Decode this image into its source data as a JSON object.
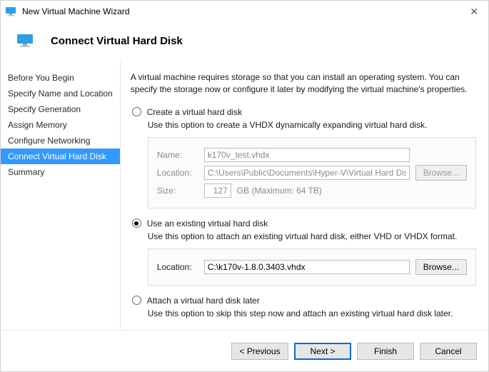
{
  "titlebar": {
    "text": "New Virtual Machine Wizard"
  },
  "header": {
    "title": "Connect Virtual Hard Disk"
  },
  "sidebar": {
    "items": [
      {
        "label": "Before You Begin"
      },
      {
        "label": "Specify Name and Location"
      },
      {
        "label": "Specify Generation"
      },
      {
        "label": "Assign Memory"
      },
      {
        "label": "Configure Networking"
      },
      {
        "label": "Connect Virtual Hard Disk"
      },
      {
        "label": "Summary"
      }
    ]
  },
  "content": {
    "intro": "A virtual machine requires storage so that you can install an operating system. You can specify the storage now or configure it later by modifying the virtual machine's properties.",
    "opt_create": {
      "label": "Create a virtual hard disk",
      "desc": "Use this option to create a VHDX dynamically expanding virtual hard disk.",
      "name_label": "Name:",
      "name_value": "k170v_test.vhdx",
      "location_label": "Location:",
      "location_value": "C:\\Users\\Public\\Documents\\Hyper-V\\Virtual Hard Disks\\",
      "browse_label": "Browse...",
      "size_label": "Size:",
      "size_value": "127",
      "size_suffix": "GB (Maximum: 64 TB)"
    },
    "opt_existing": {
      "label": "Use an existing virtual hard disk",
      "desc": "Use this option to attach an existing virtual hard disk, either VHD or VHDX format.",
      "location_label": "Location:",
      "location_value": "C:\\k170v-1.8.0.3403.vhdx",
      "browse_label": "Browse..."
    },
    "opt_later": {
      "label": "Attach a virtual hard disk later",
      "desc": "Use this option to skip this step now and attach an existing virtual hard disk later."
    }
  },
  "footer": {
    "previous": "< Previous",
    "next": "Next >",
    "finish": "Finish",
    "cancel": "Cancel"
  }
}
